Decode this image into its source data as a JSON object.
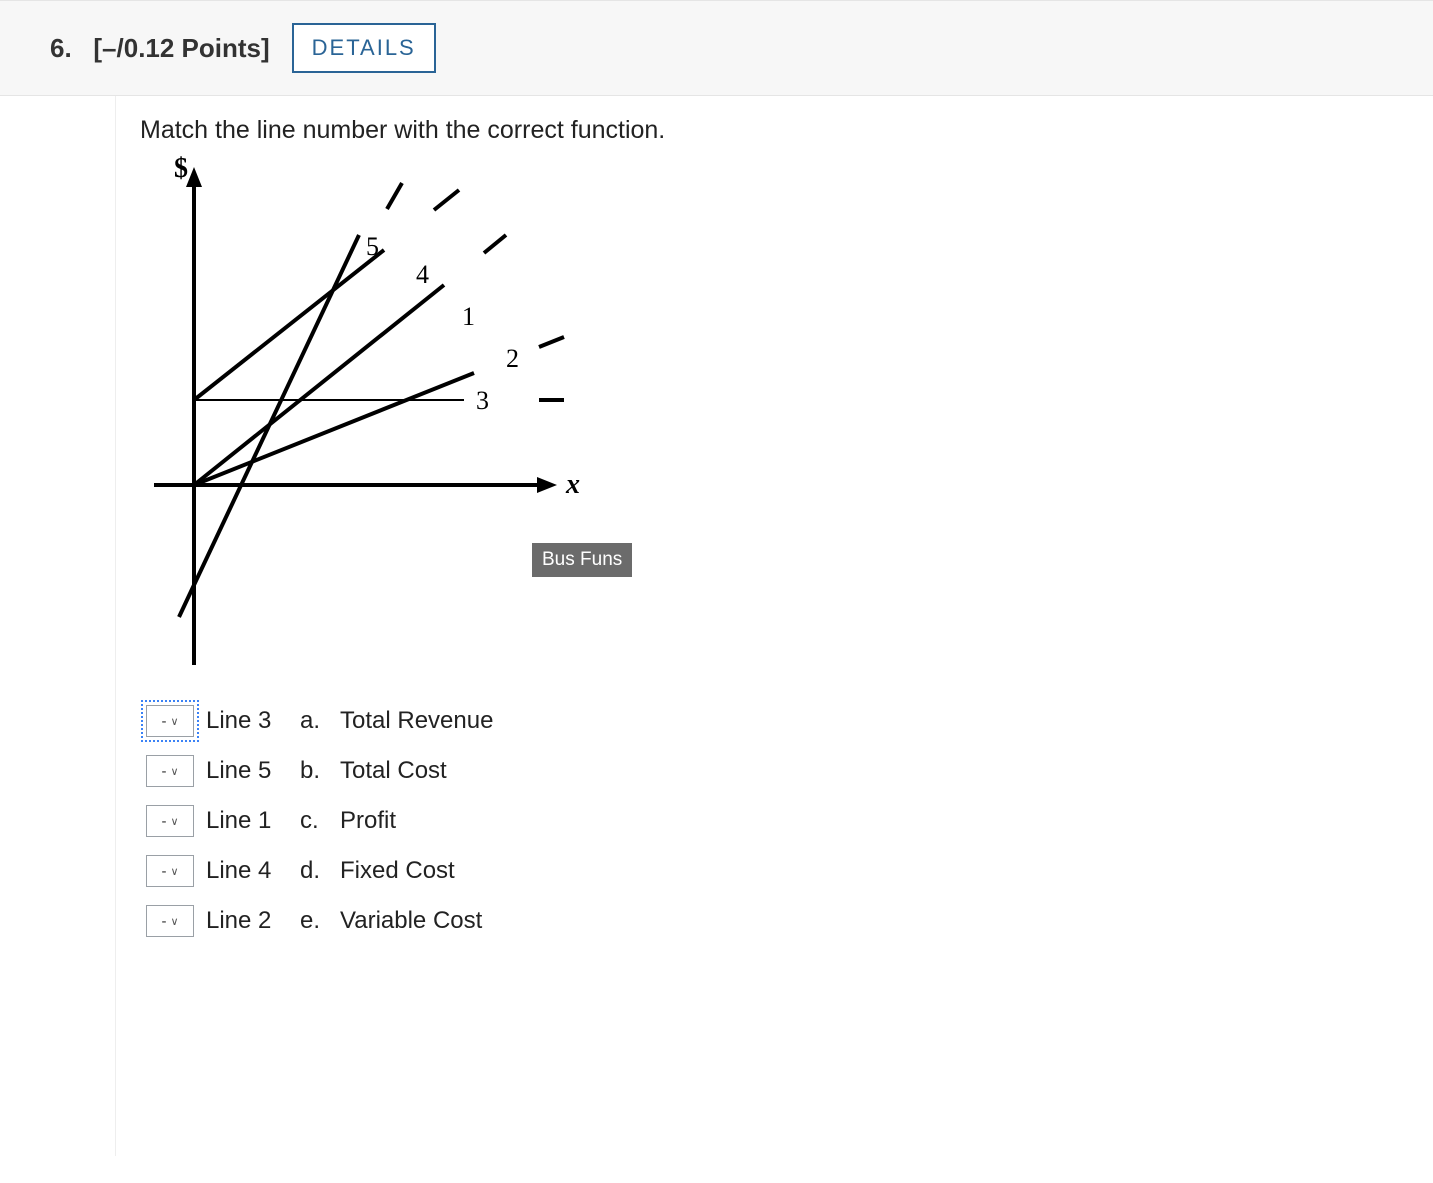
{
  "header": {
    "question_number": "6.",
    "points_text": "[–/0.12 Points]",
    "details_label": "DETAILS"
  },
  "prompt": "Match the line number with the correct function.",
  "watermark": "Bus Funs",
  "chart_data": {
    "type": "line",
    "title": "",
    "xlabel": "x",
    "ylabel": "$",
    "axes": {
      "y_label_symbol": "$",
      "x_label_symbol": "x"
    },
    "description": "Five labeled straight lines on a $ vs x graph for matching to business functions (revenue, cost, profit, fixed cost, variable cost).",
    "lines": [
      {
        "label": "1",
        "passes_through_origin": true,
        "slope": "moderate-positive",
        "y_intercept": 0
      },
      {
        "label": "2",
        "passes_through_origin": true,
        "slope": "low-positive",
        "y_intercept": 0
      },
      {
        "label": "3",
        "passes_through_origin": false,
        "slope": "zero",
        "y_intercept": "positive-constant"
      },
      {
        "label": "4",
        "passes_through_origin": false,
        "slope": "moderate-positive",
        "y_intercept": "positive"
      },
      {
        "label": "5",
        "passes_through_origin": false,
        "slope": "high-positive",
        "y_intercept": "negative"
      }
    ],
    "line_number_labels": {
      "l1": "1",
      "l2": "2",
      "l3": "3",
      "l4": "4",
      "l5": "5"
    }
  },
  "match_rows": [
    {
      "selected": "-",
      "line": "Line 3",
      "letter": "a.",
      "option": "Total Revenue",
      "focused": true
    },
    {
      "selected": "-",
      "line": "Line 5",
      "letter": "b.",
      "option": "Total Cost",
      "focused": false
    },
    {
      "selected": "-",
      "line": "Line 1",
      "letter": "c.",
      "option": "Profit",
      "focused": false
    },
    {
      "selected": "-",
      "line": "Line 4",
      "letter": "d.",
      "option": "Fixed Cost",
      "focused": false
    },
    {
      "selected": "-",
      "line": "Line 2",
      "letter": "e.",
      "option": "Variable Cost",
      "focused": false
    }
  ]
}
